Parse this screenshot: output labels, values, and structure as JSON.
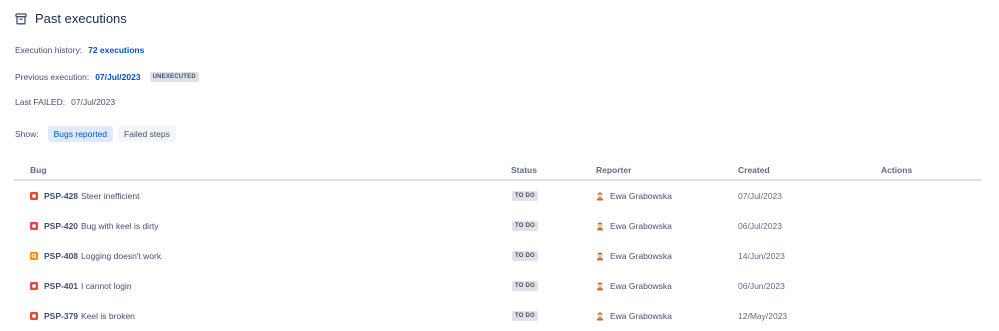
{
  "header": {
    "title": "Past executions",
    "icon": "archive-icon"
  },
  "info": {
    "history_label": "Execution history:",
    "history_value": "72 executions",
    "previous_label": "Previous execution:",
    "previous_value": "07/Jul/2023",
    "previous_status": "UNEXECUTED",
    "failed_label": "Last FAILED:",
    "failed_value": "07/Jul/2023",
    "show_label": "Show:",
    "toggles": [
      "Bugs reported",
      "Failed steps"
    ]
  },
  "table": {
    "columns": [
      "Bug",
      "Status",
      "Reporter",
      "Created",
      "Actions"
    ],
    "rows": [
      {
        "type": "bug",
        "key": "PSP-428",
        "summary": "Steer inefficient",
        "status": "TO DO",
        "reporter": "Ewa Grabowska",
        "created": "07/Jul/2023"
      },
      {
        "type": "bug",
        "key": "PSP-420",
        "summary": "Bug with keel is dirty",
        "status": "TO DO",
        "reporter": "Ewa Grabowska",
        "created": "06/Jul/2023"
      },
      {
        "type": "task",
        "key": "PSP-408",
        "summary": "Logging doesn't work",
        "status": "TO DO",
        "reporter": "Ewa Grabowska",
        "created": "14/Jun/2023"
      },
      {
        "type": "bug",
        "key": "PSP-401",
        "summary": "I cannot login",
        "status": "TO DO",
        "reporter": "Ewa Grabowska",
        "created": "06/Jun/2023"
      },
      {
        "type": "bug",
        "key": "PSP-379",
        "summary": "Keel is broken",
        "status": "TO DO",
        "reporter": "Ewa Grabowska",
        "created": "12/May/2023"
      }
    ]
  },
  "colors": {
    "link": "#0052cc",
    "bug_icon": "#e5493a",
    "task_icon": "#ff8b00",
    "lozenge_bg": "#dfe1e6",
    "active_toggle_bg": "#deebff"
  }
}
